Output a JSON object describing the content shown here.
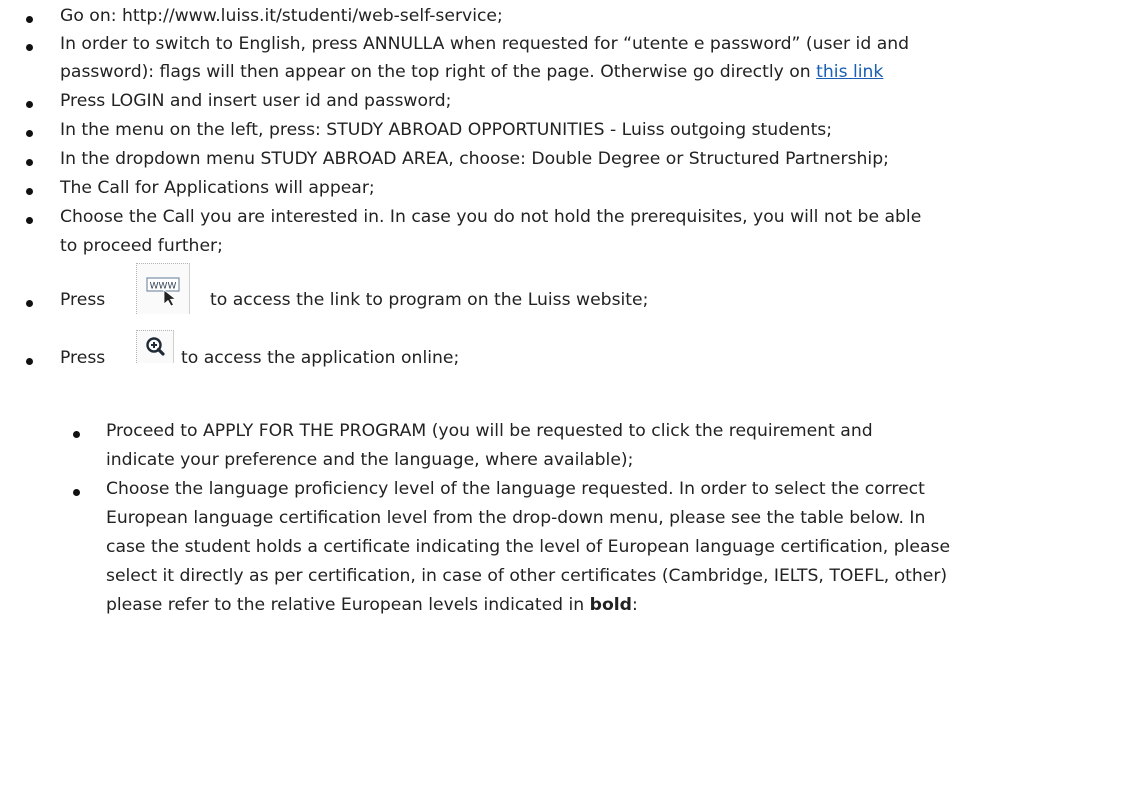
{
  "items": [
    {
      "text": "Go on: http://www.luiss.it/studenti/web-self-service;"
    },
    {
      "text_before": "In order to switch to English, press ANNULLA when requested for “utente e password” (user id and",
      "text_line2": "password): flags will then appear on the top right of the page. Otherwise go directly on",
      "link": "this link"
    },
    {
      "text": "Press LOGIN and insert user id and password;"
    },
    {
      "text": "In the menu on the left, press: STUDY ABROAD OPPORTUNITIES - Luiss outgoing students;"
    },
    {
      "text": "In the dropdown menu STUDY ABROAD AREA, choose: Double Degree or Structured Partnership;"
    },
    {
      "text": "The Call for Applications will appear;"
    },
    {
      "line1": "Choose the Call you are interested in. In case you do not hold the prerequisites, you will not be able",
      "line2": "to proceed further;"
    },
    {
      "press": "Press",
      "icon": "www-link-icon",
      "icon_text": "WWW",
      "after": "to access the link to program on the Luiss website;"
    },
    {
      "press": "Press",
      "icon": "zoom-in-icon",
      "after": "to access the application online;"
    }
  ],
  "subitems": [
    {
      "line1": "Proceed to APPLY FOR THE PROGRAM (you will be requested to click the requirement and",
      "line2": "indicate your preference and the language, where available);"
    },
    {
      "line1": "Choose the language proficiency level of the language requested. In order to select the correct",
      "line2": "European language certification level from the drop-down menu, please see the table below. In",
      "line3": "case the student holds a certificate indicating the level of European language certification, please",
      "line4": "select it directly as per certification, in case of other certificates (Cambridge, IELTS, TOEFL, other)",
      "line5_before": "please refer to the relative European levels indicated in",
      "line5_bold": "bold",
      "line5_after": ":"
    }
  ]
}
